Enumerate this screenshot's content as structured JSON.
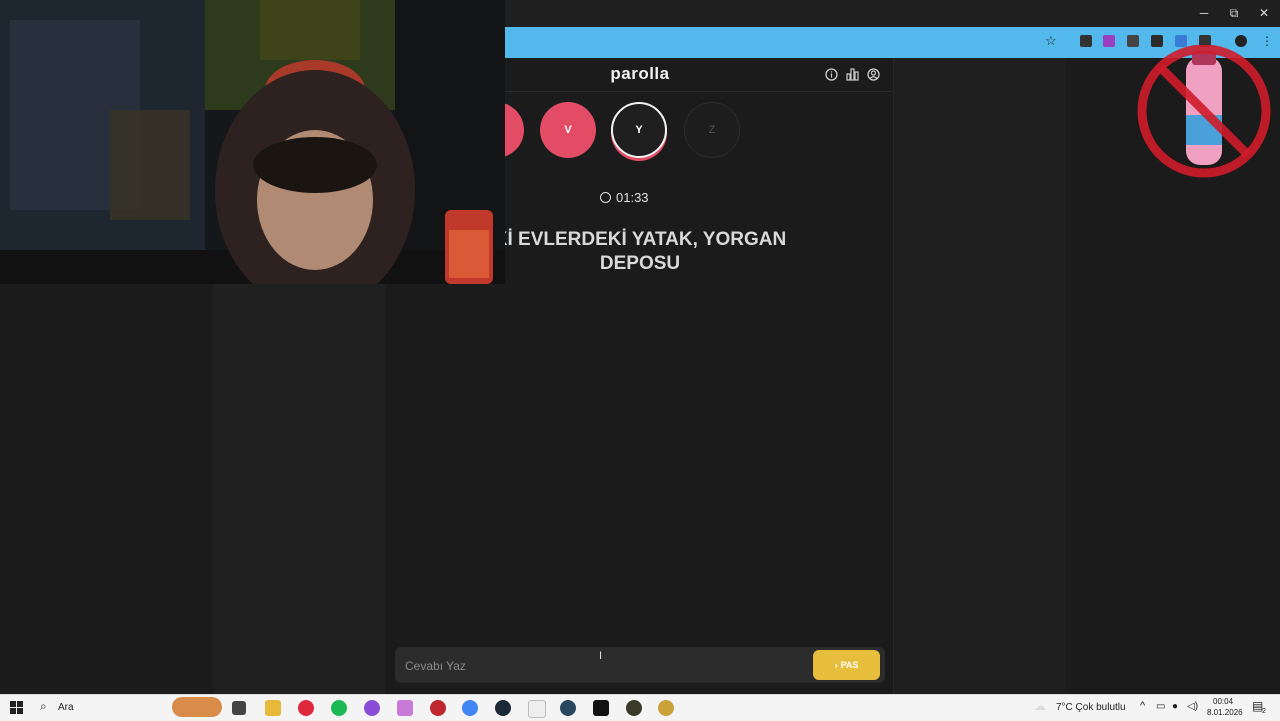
{
  "browser": {
    "window_controls": {
      "minimize": "─",
      "restore": "⧉",
      "close": "✕"
    }
  },
  "app": {
    "logo": "parolla",
    "header_icons": [
      "info-icon",
      "stats-icon",
      "profile-icon"
    ]
  },
  "letters": [
    {
      "letter": "",
      "state": "answered"
    },
    {
      "letter": "V",
      "state": "answered"
    },
    {
      "letter": "Y",
      "state": "active"
    },
    {
      "letter": "Z",
      "state": "pending"
    }
  ],
  "timer": "01:33",
  "question": "Kİ EVLERDEKİ YATAK, YORGAN DEPOSU",
  "answer": {
    "placeholder": "Cevabı Yaz",
    "pass_label": "PAS"
  },
  "taskbar": {
    "search_label": "Ara",
    "weather": "7°C  Çok bulutlu",
    "time": "00:04",
    "date": "8.01.2026",
    "notification_count": "2"
  },
  "colors": {
    "accent_red": "#e24d65",
    "pass_yellow": "#e7be3b",
    "url_blue": "#53b9ec"
  }
}
